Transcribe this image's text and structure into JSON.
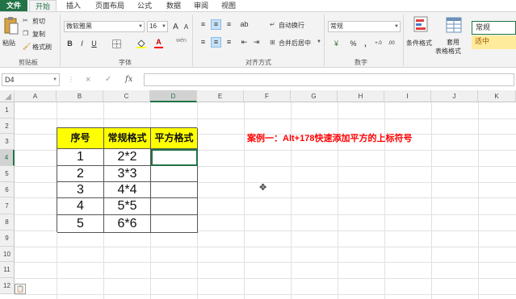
{
  "tabs": [
    "文件",
    "开始",
    "插入",
    "页面布局",
    "公式",
    "数据",
    "审阅",
    "视图"
  ],
  "clipboard": {
    "paste": "粘贴",
    "cut": "剪切",
    "copy": "复制",
    "format_painter": "格式刷",
    "label": "剪贴板"
  },
  "font": {
    "name": "微软雅黑",
    "size": "16",
    "grow": "A",
    "shrink": "A",
    "bold": "B",
    "italic": "I",
    "underline": "U",
    "color_letter": "A",
    "wen": "wén",
    "label": "字体"
  },
  "alignment": {
    "wrap": "自动换行",
    "merge": "合并后居中",
    "label": "对齐方式"
  },
  "number": {
    "format": "常规",
    "percent": "%",
    "comma": ",",
    "label": "数字"
  },
  "styles": {
    "conditional": "条件格式",
    "table_line1": "套用",
    "table_line2": "表格格式",
    "normal": "常规",
    "neutral": "适中"
  },
  "formula_bar": {
    "name_box": "D4",
    "fx": "fx",
    "cancel": "×",
    "enter": "✓"
  },
  "columns": [
    "A",
    "B",
    "C",
    "D",
    "E",
    "F",
    "G",
    "H",
    "I",
    "J",
    "K"
  ],
  "rows": [
    "1",
    "2",
    "3",
    "4",
    "5",
    "6",
    "7",
    "8",
    "9",
    "10",
    "11",
    "12"
  ],
  "table": {
    "headers": [
      "序号",
      "常规格式",
      "平方格式"
    ],
    "rows": [
      [
        "1",
        "2*2",
        ""
      ],
      [
        "2",
        "3*3",
        ""
      ],
      [
        "3",
        "4*4",
        ""
      ],
      [
        "4",
        "5*5",
        ""
      ],
      [
        "5",
        "6*6",
        ""
      ]
    ]
  },
  "note": "案例一：Alt+178快速添加平方的上标符号",
  "colors": {
    "accent": "#217346",
    "header_fill": "#ffff00",
    "note": "#ff0000",
    "neutral_fill": "#ffeb9c"
  }
}
